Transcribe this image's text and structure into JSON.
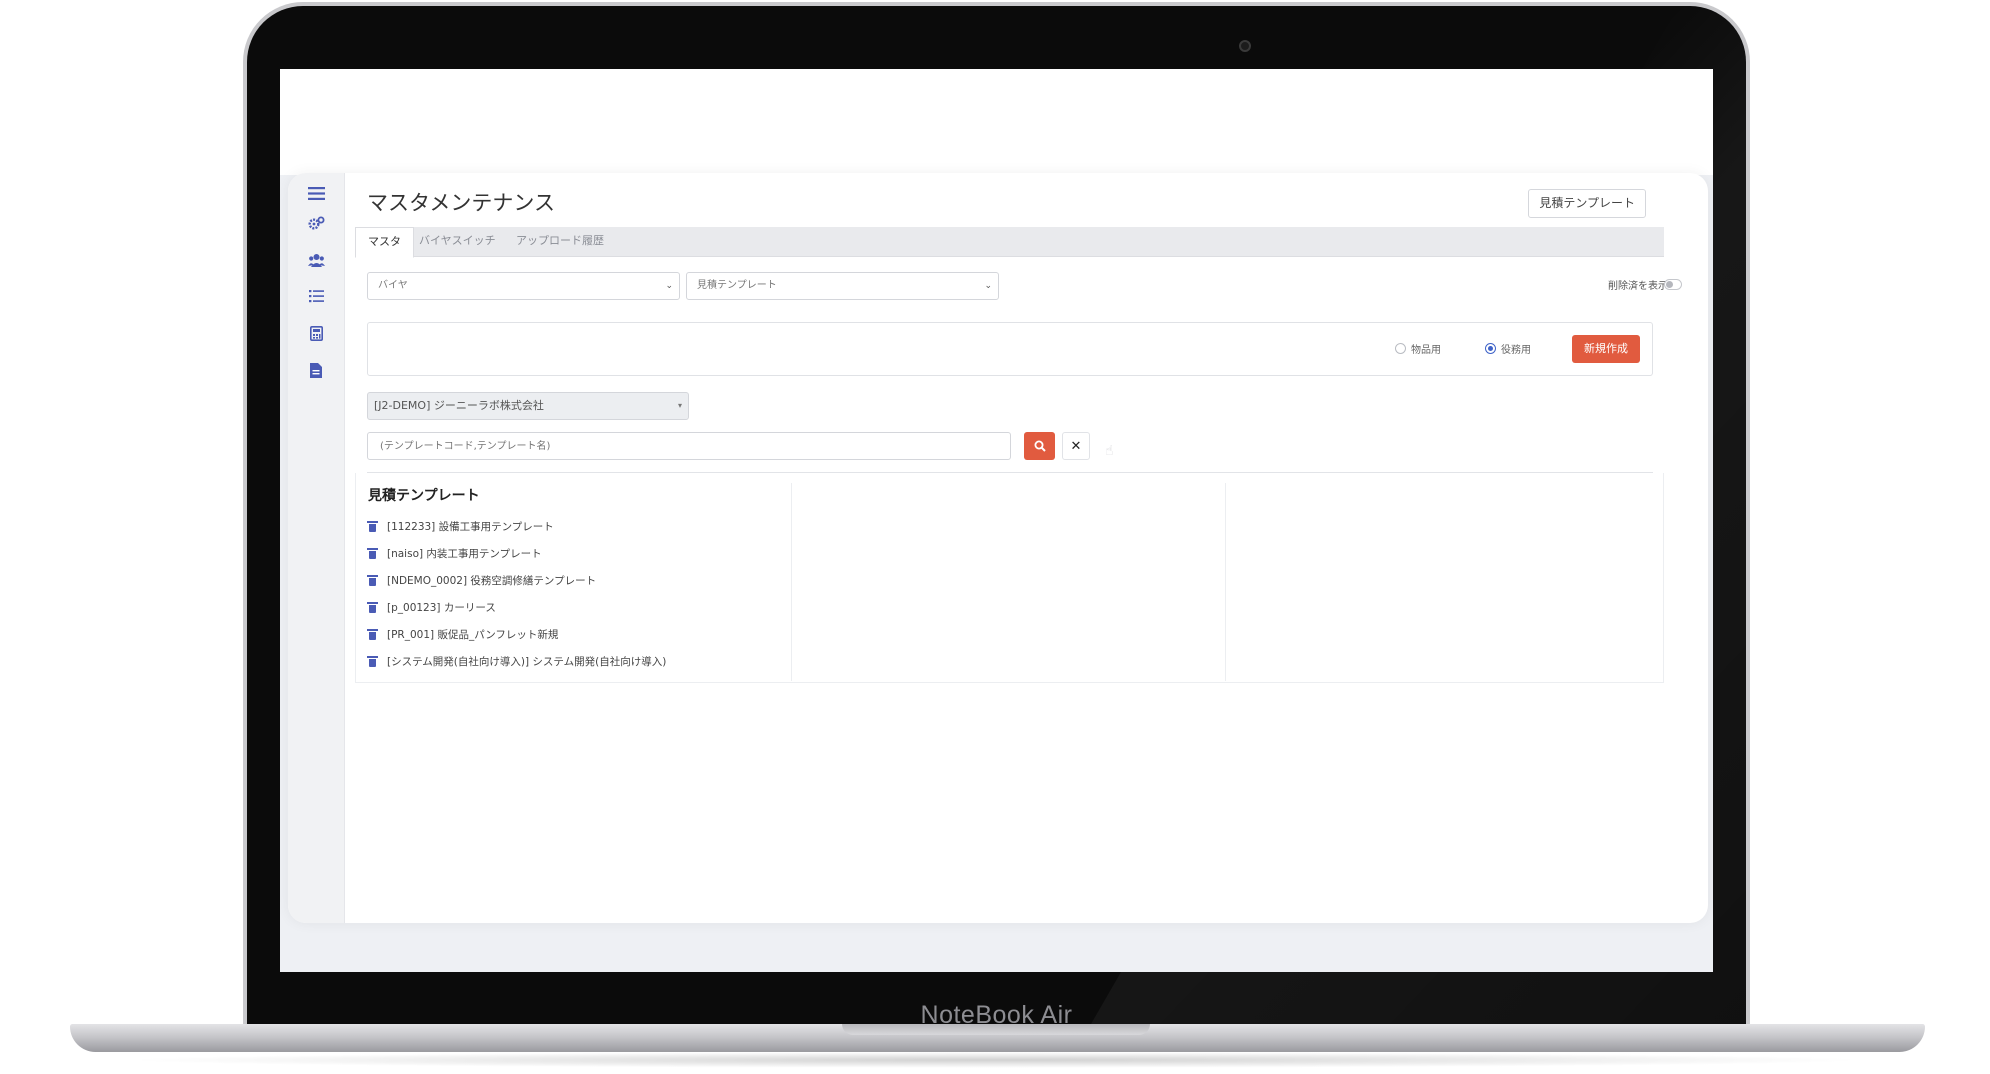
{
  "device": {
    "brand_label": "NoteBook Air"
  },
  "app": {
    "page_title": "マスタメンテナンス",
    "header_button": "見積テンプレート",
    "tabs": [
      {
        "label": "マスタ",
        "active": true
      },
      {
        "label": "バイヤスイッチ",
        "active": false
      },
      {
        "label": "アップロード履歴",
        "active": false
      }
    ],
    "filters": {
      "category_select": "バイヤ",
      "master_select": "見積テンプレート",
      "show_deleted_label": "削除済を表示",
      "show_deleted_on": false
    },
    "actions": {
      "radio_goods": "物品用",
      "radio_service": "役務用",
      "selected": "役務用",
      "create_button": "新規作成"
    },
    "company_select": "[J2-DEMO] ジーニーラボ株式会社",
    "search": {
      "placeholder": "(テンプレートコード,テンプレート名)",
      "value": ""
    },
    "list": {
      "title": "見積テンプレート",
      "items": [
        "[112233] 設備工事用テンプレート",
        "[naiso] 内装工事用テンプレート",
        "[NDEMO_0002] 役務空調修繕テンプレート",
        "[p_00123] カーリース",
        "[PR_001] 販促品_パンフレット新規",
        "[システム開発(自社向け導入)] システム開発(自社向け導入)"
      ]
    },
    "sidebar_icons": [
      "menu-icon",
      "gears-icon",
      "users-icon",
      "list-check-icon",
      "calculator-icon",
      "file-icon"
    ],
    "colors": {
      "accent": "#e15b3f",
      "icon_blue": "#4a5bb5"
    }
  }
}
